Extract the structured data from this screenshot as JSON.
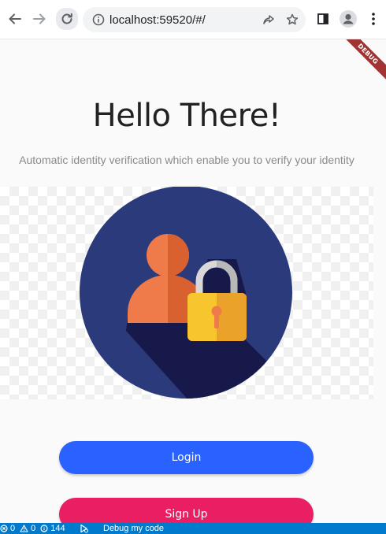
{
  "browser": {
    "url": "localhost:59520/#/",
    "icons": [
      "back-arrow-icon",
      "forward-arrow-icon",
      "reload-icon",
      "info-icon",
      "share-icon",
      "bookmark-star-icon",
      "side-panel-icon",
      "profile-icon",
      "more-menu-icon"
    ]
  },
  "debug_banner": {
    "label": "DEBUG",
    "color": "#a03434"
  },
  "app": {
    "title": "Hello There!",
    "subtitle": "Automatic identity verification which enable you to verify your identity",
    "hero_icons": [
      "user-lock-illustration"
    ],
    "login_label": "Login",
    "signup_label": "Sign Up",
    "colors": {
      "login": "#2962ff",
      "signup": "#e91e63",
      "circle": "#2b3a7a"
    }
  },
  "statusbar": {
    "errors": "0",
    "warnings": "0",
    "info": "144",
    "debug_label": "Debug my code",
    "color": "#007acc"
  }
}
